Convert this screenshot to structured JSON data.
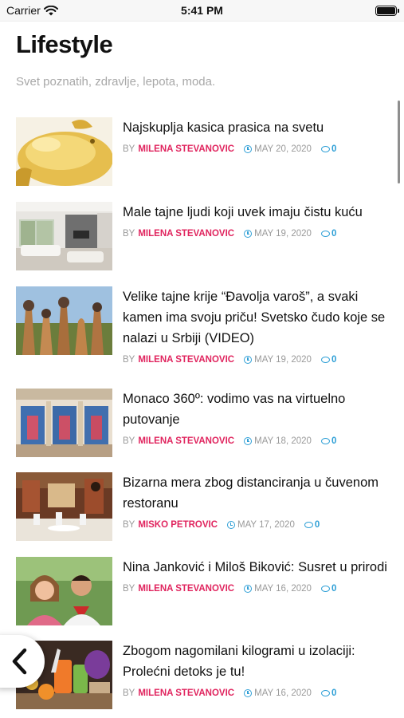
{
  "status_bar": {
    "carrier": "Carrier",
    "time": "5:41 PM"
  },
  "page": {
    "title": "Lifestyle",
    "subtitle": "Svet poznatih, zdravlje, lepota, moda."
  },
  "articles": [
    {
      "title": "Najskuplja kasica prasica na svetu",
      "by": "BY",
      "author": "MILENA STEVANOVIC",
      "date": "MAY 20, 2020",
      "comments": "0",
      "image": "golden-piggy-bank"
    },
    {
      "title": "Male tajne ljudi koji uvek imaju čistu kuću",
      "by": "BY",
      "author": "MILENA STEVANOVIC",
      "date": "MAY 19, 2020",
      "comments": "0",
      "image": "clean-living-room"
    },
    {
      "title": "Velike tajne krije “Đavolja varoš”, a svaki kamen ima svoju priču! Svetsko čudo koje se nalazi u Srbiji (VIDEO)",
      "by": "BY",
      "author": "MILENA STEVANOVIC",
      "date": "MAY 19, 2020",
      "comments": "0",
      "image": "rock-formations"
    },
    {
      "title": "Monaco 360º: vodimo vas na virtuelno putovanje",
      "by": "BY",
      "author": "MILENA STEVANOVIC",
      "date": "MAY 18, 2020",
      "comments": "0",
      "image": "monaco-building"
    },
    {
      "title": "Bizarna mera zbog distanciranja u čuvenom restoranu",
      "by": "BY",
      "author": "MISKO PETROVIC",
      "date": "MAY 17, 2020",
      "comments": "0",
      "image": "restaurant-interior"
    },
    {
      "title": "Nina Janković i Miloš Biković: Susret u prirodi",
      "by": "BY",
      "author": "MILENA STEVANOVIC",
      "date": "MAY 16, 2020",
      "comments": "0",
      "image": "couple-selfie"
    },
    {
      "title": "Zbogom nagomilani kilogrami u izolaciji: Prolećni detoks je tu!",
      "by": "BY",
      "author": "MILENA STEVANOVIC",
      "date": "MAY 16, 2020",
      "comments": "0",
      "image": "detox-juices"
    }
  ],
  "colors": {
    "accent_author": "#e0245e",
    "accent_meta": "#2e9fd6",
    "subtitle": "#a8a8a8"
  },
  "icons": {
    "back": "chevron-left-icon",
    "clock": "clock-icon",
    "comment": "comment-icon",
    "wifi": "wifi-icon",
    "battery": "battery-icon"
  }
}
